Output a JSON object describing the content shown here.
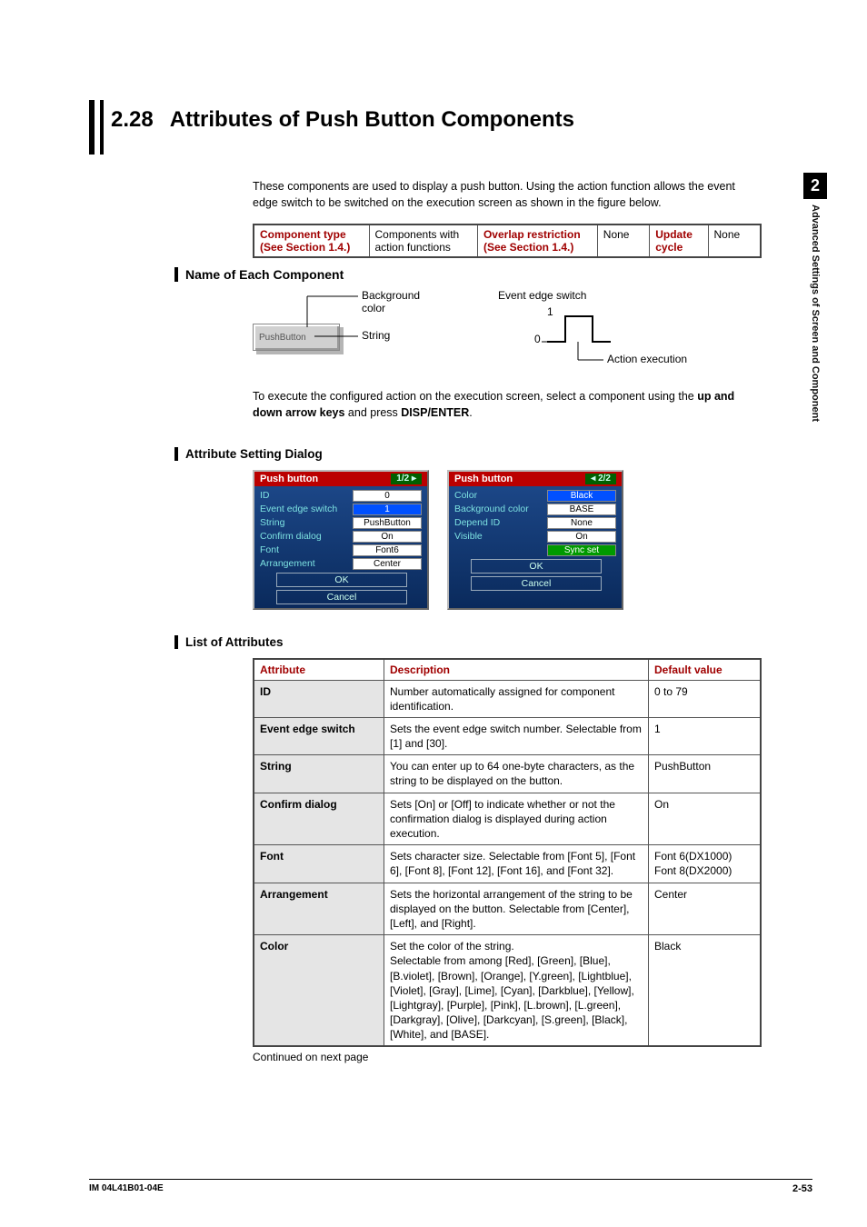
{
  "side": {
    "chapter_num": "2",
    "chapter_text": "Advanced Settings of Screen and Component"
  },
  "section": {
    "num": "2.28",
    "title": "Attributes of Push Button Components"
  },
  "intro": "These components are used to display a push button.  Using the action function allows the event edge switch to be switched on the execution screen as shown in the figure below.",
  "info_table": {
    "h1": "Component type (See Section 1.4.)",
    "v1": "Components with action functions",
    "h2": "Overlap restriction (See Section 1.4.)",
    "v2": "None",
    "h3": "Update cycle",
    "v3": "None"
  },
  "subhead_name": "Name of Each Component",
  "diagram": {
    "bg_color": "Background color",
    "string": "String",
    "button_text": "PushButton",
    "event_label": "Event edge switch",
    "one": "1",
    "zero": "0",
    "action": "Action execution"
  },
  "exec_text": {
    "p1a": "To execute the configured action on the execution screen, select a component using the ",
    "p1b": "up and down arrow keys",
    "p1c": " and press ",
    "p1d": "DISP/ENTER",
    "p1e": "."
  },
  "subhead_dialog": "Attribute Setting Dialog",
  "dialog1": {
    "title": "Push button",
    "page": "1/2 ▸",
    "rows": [
      {
        "label": "ID",
        "value": "0",
        "cls": ""
      },
      {
        "label": "Event edge switch",
        "value": "1",
        "cls": "blue"
      },
      {
        "label": "String",
        "value": "PushButton",
        "cls": ""
      },
      {
        "label": "Confirm dialog",
        "value": "On",
        "cls": ""
      },
      {
        "label": "Font",
        "value": "Font6",
        "cls": ""
      },
      {
        "label": "Arrangement",
        "value": "Center",
        "cls": ""
      }
    ],
    "ok": "OK",
    "cancel": "Cancel"
  },
  "dialog2": {
    "title": "Push button",
    "page": "◂ 2/2",
    "rows": [
      {
        "label": "Color",
        "value": "Black",
        "cls": "blue"
      },
      {
        "label": "Background color",
        "value": "BASE",
        "cls": ""
      },
      {
        "label": "Depend ID",
        "value": "None",
        "cls": ""
      },
      {
        "label": "Visible",
        "value": "On",
        "cls": ""
      },
      {
        "label": "",
        "value": "Sync set",
        "cls": "green"
      }
    ],
    "ok": "OK",
    "cancel": "Cancel"
  },
  "subhead_list": "List of Attributes",
  "attr_headers": {
    "attr": "Attribute",
    "desc": "Description",
    "def": "Default value"
  },
  "attr_rows": [
    {
      "a": "ID",
      "d": "Number automatically assigned for component identification.",
      "v": "0 to 79"
    },
    {
      "a": "Event edge switch",
      "d": "Sets the event edge switch number. Selectable from [1] and [30].",
      "v": "1"
    },
    {
      "a": "String",
      "d": "You can enter up to 64 one-byte characters, as the string to be displayed on the button.",
      "v": "PushButton"
    },
    {
      "a": "Confirm dialog",
      "d": "Sets [On] or [Off] to indicate whether or not the confirmation dialog is displayed during action execution.",
      "v": "On"
    },
    {
      "a": "Font",
      "d": "Sets character size. Selectable from [Font 5], [Font 6], [Font 8], [Font 12], [Font 16], and [Font 32].",
      "v": "Font 6(DX1000) Font 8(DX2000)"
    },
    {
      "a": "Arrangement",
      "d": "Sets the horizontal arrangement of the string to be displayed on the button.  Selectable from [Center], [Left], and [Right].",
      "v": "Center"
    },
    {
      "a": "Color",
      "d": "Set the color of the string.\nSelectable from among [Red], [Green], [Blue], [B.violet], [Brown], [Orange], [Y.green], [Lightblue], [Violet], [Gray], [Lime], [Cyan], [Darkblue], [Yellow], [Lightgray], [Purple], [Pink], [L.brown], [L.green], [Darkgray], [Olive], [Darkcyan], [S.green], [Black], [White], and [BASE].",
      "v": "Black"
    }
  ],
  "continued": "Continued on next page",
  "footer": {
    "left": "IM 04L41B01-04E",
    "right": "2-53"
  }
}
